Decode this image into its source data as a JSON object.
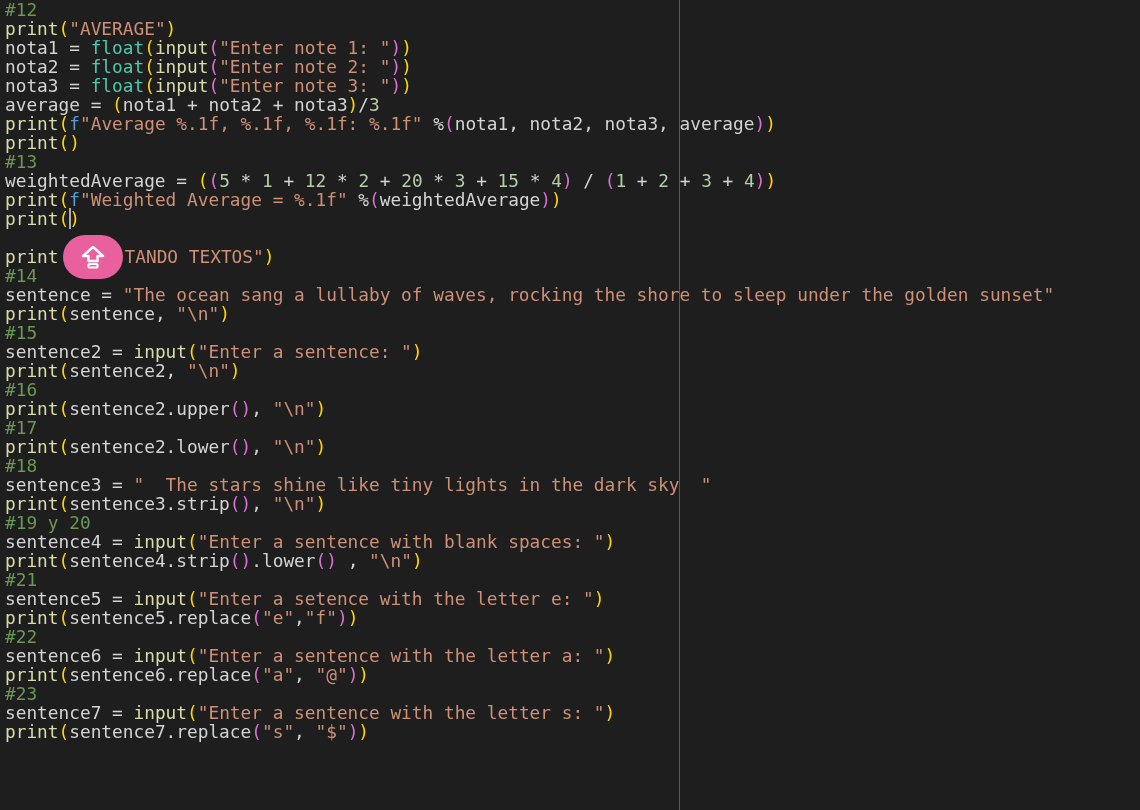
{
  "editor": {
    "lines": [
      {
        "kind": "code",
        "tokens": [
          {
            "kind": "comment",
            "text": "#12"
          }
        ]
      },
      {
        "kind": "code",
        "tokens": [
          {
            "kind": "fn",
            "text": "print"
          },
          {
            "kind": "paren1",
            "text": "("
          },
          {
            "kind": "string",
            "text": "\"AVERAGE\""
          },
          {
            "kind": "paren1",
            "text": ")"
          }
        ]
      },
      {
        "kind": "code",
        "tokens": [
          {
            "kind": "plain",
            "text": "nota1 = "
          },
          {
            "kind": "type",
            "text": "float"
          },
          {
            "kind": "paren1",
            "text": "("
          },
          {
            "kind": "fn",
            "text": "input"
          },
          {
            "kind": "paren2",
            "text": "("
          },
          {
            "kind": "string",
            "text": "\"Enter note 1: \""
          },
          {
            "kind": "paren2",
            "text": ")"
          },
          {
            "kind": "paren1",
            "text": ")"
          }
        ]
      },
      {
        "kind": "code",
        "tokens": [
          {
            "kind": "plain",
            "text": "nota2 = "
          },
          {
            "kind": "type",
            "text": "float"
          },
          {
            "kind": "paren1",
            "text": "("
          },
          {
            "kind": "fn",
            "text": "input"
          },
          {
            "kind": "paren2",
            "text": "("
          },
          {
            "kind": "string",
            "text": "\"Enter note 2: \""
          },
          {
            "kind": "paren2",
            "text": ")"
          },
          {
            "kind": "paren1",
            "text": ")"
          }
        ]
      },
      {
        "kind": "code",
        "tokens": [
          {
            "kind": "plain",
            "text": "nota3 = "
          },
          {
            "kind": "type",
            "text": "float"
          },
          {
            "kind": "paren1",
            "text": "("
          },
          {
            "kind": "fn",
            "text": "input"
          },
          {
            "kind": "paren2",
            "text": "("
          },
          {
            "kind": "string",
            "text": "\"Enter note 3: \""
          },
          {
            "kind": "paren2",
            "text": ")"
          },
          {
            "kind": "paren1",
            "text": ")"
          }
        ]
      },
      {
        "kind": "code",
        "tokens": [
          {
            "kind": "plain",
            "text": "average = "
          },
          {
            "kind": "paren1",
            "text": "("
          },
          {
            "kind": "plain",
            "text": "nota1 + nota2 + nota3"
          },
          {
            "kind": "paren1",
            "text": ")"
          },
          {
            "kind": "plain",
            "text": "/"
          },
          {
            "kind": "number",
            "text": "3"
          }
        ]
      },
      {
        "kind": "code",
        "tokens": [
          {
            "kind": "fn",
            "text": "print"
          },
          {
            "kind": "paren1",
            "text": "("
          },
          {
            "kind": "prefix",
            "text": "f"
          },
          {
            "kind": "string",
            "text": "\"Average %.1f, %.1f, %.1f: %.1f\""
          },
          {
            "kind": "plain",
            "text": " %"
          },
          {
            "kind": "paren2",
            "text": "("
          },
          {
            "kind": "plain",
            "text": "nota1, nota2, nota3, average"
          },
          {
            "kind": "paren2",
            "text": ")"
          },
          {
            "kind": "paren1",
            "text": ")"
          }
        ]
      },
      {
        "kind": "code",
        "tokens": [
          {
            "kind": "fn",
            "text": "print"
          },
          {
            "kind": "paren1",
            "text": "()"
          }
        ]
      },
      {
        "kind": "code",
        "tokens": [
          {
            "kind": "comment",
            "text": "#13"
          }
        ]
      },
      {
        "kind": "code",
        "tokens": [
          {
            "kind": "plain",
            "text": "weightedAverage = "
          },
          {
            "kind": "paren1",
            "text": "("
          },
          {
            "kind": "paren2",
            "text": "("
          },
          {
            "kind": "number",
            "text": "5"
          },
          {
            "kind": "plain",
            "text": " * "
          },
          {
            "kind": "number",
            "text": "1"
          },
          {
            "kind": "plain",
            "text": " + "
          },
          {
            "kind": "number",
            "text": "12"
          },
          {
            "kind": "plain",
            "text": " * "
          },
          {
            "kind": "number",
            "text": "2"
          },
          {
            "kind": "plain",
            "text": " + "
          },
          {
            "kind": "number",
            "text": "20"
          },
          {
            "kind": "plain",
            "text": " * "
          },
          {
            "kind": "number",
            "text": "3"
          },
          {
            "kind": "plain",
            "text": " + "
          },
          {
            "kind": "number",
            "text": "15"
          },
          {
            "kind": "plain",
            "text": " * "
          },
          {
            "kind": "number",
            "text": "4"
          },
          {
            "kind": "paren2",
            "text": ")"
          },
          {
            "kind": "plain",
            "text": " / "
          },
          {
            "kind": "paren2",
            "text": "("
          },
          {
            "kind": "number",
            "text": "1"
          },
          {
            "kind": "plain",
            "text": " + "
          },
          {
            "kind": "number",
            "text": "2"
          },
          {
            "kind": "plain",
            "text": " + "
          },
          {
            "kind": "number",
            "text": "3"
          },
          {
            "kind": "plain",
            "text": " + "
          },
          {
            "kind": "number",
            "text": "4"
          },
          {
            "kind": "paren2",
            "text": ")"
          },
          {
            "kind": "paren1",
            "text": ")"
          }
        ]
      },
      {
        "kind": "code",
        "tokens": [
          {
            "kind": "fn",
            "text": "print"
          },
          {
            "kind": "paren1",
            "text": "("
          },
          {
            "kind": "prefix",
            "text": "f"
          },
          {
            "kind": "string",
            "text": "\"Weighted Average = %.1f\""
          },
          {
            "kind": "plain",
            "text": " %"
          },
          {
            "kind": "paren2",
            "text": "("
          },
          {
            "kind": "plain",
            "text": "weightedAverage"
          },
          {
            "kind": "paren2",
            "text": ")"
          },
          {
            "kind": "paren1",
            "text": ")"
          }
        ]
      },
      {
        "kind": "code",
        "tokens": [
          {
            "kind": "fn",
            "text": "print"
          },
          {
            "kind": "paren1",
            "text": "("
          },
          {
            "kind": "paren1",
            "text": ")",
            "caret": true
          }
        ]
      },
      {
        "kind": "blank"
      },
      {
        "kind": "code",
        "tokens": [
          {
            "kind": "fn",
            "text": "print"
          },
          {
            "kind": "upload_button"
          },
          {
            "kind": "string",
            "text": "TANDO TEXTOS\""
          },
          {
            "kind": "paren1",
            "text": ")"
          }
        ]
      },
      {
        "kind": "code",
        "tokens": [
          {
            "kind": "comment",
            "text": "#14"
          }
        ]
      },
      {
        "kind": "code",
        "tokens": [
          {
            "kind": "plain",
            "text": "sentence = "
          },
          {
            "kind": "string",
            "text": "\"The ocean sang a lullaby of waves, rocking the shore to sleep under the golden sunset\""
          }
        ]
      },
      {
        "kind": "code",
        "tokens": [
          {
            "kind": "fn",
            "text": "print"
          },
          {
            "kind": "paren1",
            "text": "("
          },
          {
            "kind": "plain",
            "text": "sentence, "
          },
          {
            "kind": "string",
            "text": "\"\\n\""
          },
          {
            "kind": "paren1",
            "text": ")"
          }
        ]
      },
      {
        "kind": "code",
        "tokens": [
          {
            "kind": "comment",
            "text": "#15"
          }
        ]
      },
      {
        "kind": "code",
        "tokens": [
          {
            "kind": "plain",
            "text": "sentence2 = "
          },
          {
            "kind": "fn",
            "text": "input"
          },
          {
            "kind": "paren1",
            "text": "("
          },
          {
            "kind": "string",
            "text": "\"Enter a sentence: \""
          },
          {
            "kind": "paren1",
            "text": ")"
          }
        ]
      },
      {
        "kind": "code",
        "tokens": [
          {
            "kind": "fn",
            "text": "print"
          },
          {
            "kind": "paren1",
            "text": "("
          },
          {
            "kind": "plain",
            "text": "sentence2, "
          },
          {
            "kind": "string",
            "text": "\"\\n\""
          },
          {
            "kind": "paren1",
            "text": ")"
          }
        ]
      },
      {
        "kind": "code",
        "tokens": [
          {
            "kind": "comment",
            "text": "#16"
          }
        ]
      },
      {
        "kind": "code",
        "tokens": [
          {
            "kind": "fn",
            "text": "print"
          },
          {
            "kind": "paren1",
            "text": "("
          },
          {
            "kind": "plain",
            "text": "sentence2.upper"
          },
          {
            "kind": "paren2",
            "text": "()"
          },
          {
            "kind": "plain",
            "text": ", "
          },
          {
            "kind": "string",
            "text": "\"\\n\""
          },
          {
            "kind": "paren1",
            "text": ")"
          }
        ]
      },
      {
        "kind": "code",
        "tokens": [
          {
            "kind": "comment",
            "text": "#17"
          }
        ]
      },
      {
        "kind": "code",
        "tokens": [
          {
            "kind": "fn",
            "text": "print"
          },
          {
            "kind": "paren1",
            "text": "("
          },
          {
            "kind": "plain",
            "text": "sentence2.lower"
          },
          {
            "kind": "paren2",
            "text": "()"
          },
          {
            "kind": "plain",
            "text": ", "
          },
          {
            "kind": "string",
            "text": "\"\\n\""
          },
          {
            "kind": "paren1",
            "text": ")"
          }
        ]
      },
      {
        "kind": "code",
        "tokens": [
          {
            "kind": "comment",
            "text": "#18"
          }
        ]
      },
      {
        "kind": "code",
        "tokens": [
          {
            "kind": "plain",
            "text": "sentence3 = "
          },
          {
            "kind": "string",
            "text": "\"  The stars shine like tiny lights in the dark sky  \""
          }
        ]
      },
      {
        "kind": "code",
        "tokens": [
          {
            "kind": "fn",
            "text": "print"
          },
          {
            "kind": "paren1",
            "text": "("
          },
          {
            "kind": "plain",
            "text": "sentence3.strip"
          },
          {
            "kind": "paren2",
            "text": "()"
          },
          {
            "kind": "plain",
            "text": ", "
          },
          {
            "kind": "string",
            "text": "\"\\n\""
          },
          {
            "kind": "paren1",
            "text": ")"
          }
        ]
      },
      {
        "kind": "code",
        "tokens": [
          {
            "kind": "comment",
            "text": "#19 y 20"
          }
        ]
      },
      {
        "kind": "code",
        "tokens": [
          {
            "kind": "plain",
            "text": "sentence4 = "
          },
          {
            "kind": "fn",
            "text": "input"
          },
          {
            "kind": "paren1",
            "text": "("
          },
          {
            "kind": "string",
            "text": "\"Enter a sentence with blank spaces: \""
          },
          {
            "kind": "paren1",
            "text": ")"
          }
        ]
      },
      {
        "kind": "code",
        "tokens": [
          {
            "kind": "fn",
            "text": "print"
          },
          {
            "kind": "paren1",
            "text": "("
          },
          {
            "kind": "plain",
            "text": "sentence4.strip"
          },
          {
            "kind": "paren2",
            "text": "()"
          },
          {
            "kind": "plain",
            "text": ".lower"
          },
          {
            "kind": "paren2",
            "text": "()"
          },
          {
            "kind": "plain",
            "text": " , "
          },
          {
            "kind": "string",
            "text": "\"\\n\""
          },
          {
            "kind": "paren1",
            "text": ")"
          }
        ]
      },
      {
        "kind": "code",
        "tokens": [
          {
            "kind": "comment",
            "text": "#21"
          }
        ]
      },
      {
        "kind": "code",
        "tokens": [
          {
            "kind": "plain",
            "text": "sentence5 = "
          },
          {
            "kind": "fn",
            "text": "input"
          },
          {
            "kind": "paren1",
            "text": "("
          },
          {
            "kind": "string",
            "text": "\"Enter a setence with the letter e: \""
          },
          {
            "kind": "paren1",
            "text": ")"
          }
        ]
      },
      {
        "kind": "code",
        "tokens": [
          {
            "kind": "fn",
            "text": "print"
          },
          {
            "kind": "paren1",
            "text": "("
          },
          {
            "kind": "plain",
            "text": "sentence5.replace"
          },
          {
            "kind": "paren2",
            "text": "("
          },
          {
            "kind": "string",
            "text": "\"e\""
          },
          {
            "kind": "plain",
            "text": ","
          },
          {
            "kind": "string",
            "text": "\"f\""
          },
          {
            "kind": "paren2",
            "text": ")"
          },
          {
            "kind": "paren1",
            "text": ")"
          }
        ]
      },
      {
        "kind": "code",
        "tokens": [
          {
            "kind": "comment",
            "text": "#22"
          }
        ]
      },
      {
        "kind": "code",
        "tokens": [
          {
            "kind": "plain",
            "text": "sentence6 = "
          },
          {
            "kind": "fn",
            "text": "input"
          },
          {
            "kind": "paren1",
            "text": "("
          },
          {
            "kind": "string",
            "text": "\"Enter a sentence with the letter a: \""
          },
          {
            "kind": "paren1",
            "text": ")"
          }
        ]
      },
      {
        "kind": "code",
        "tokens": [
          {
            "kind": "fn",
            "text": "print"
          },
          {
            "kind": "paren1",
            "text": "("
          },
          {
            "kind": "plain",
            "text": "sentence6.replace"
          },
          {
            "kind": "paren2",
            "text": "("
          },
          {
            "kind": "string",
            "text": "\"a\""
          },
          {
            "kind": "plain",
            "text": ", "
          },
          {
            "kind": "string",
            "text": "\"@\""
          },
          {
            "kind": "paren2",
            "text": ")"
          },
          {
            "kind": "paren1",
            "text": ")"
          }
        ]
      },
      {
        "kind": "code",
        "tokens": [
          {
            "kind": "comment",
            "text": "#23"
          }
        ]
      },
      {
        "kind": "code",
        "tokens": [
          {
            "kind": "plain",
            "text": "sentence7 = "
          },
          {
            "kind": "fn",
            "text": "input"
          },
          {
            "kind": "paren1",
            "text": "("
          },
          {
            "kind": "string",
            "text": "\"Enter a sentence with the letter s: \""
          },
          {
            "kind": "paren1",
            "text": ")"
          }
        ]
      },
      {
        "kind": "code",
        "tokens": [
          {
            "kind": "fn",
            "text": "print"
          },
          {
            "kind": "paren1",
            "text": "("
          },
          {
            "kind": "plain",
            "text": "sentence7.replace"
          },
          {
            "kind": "paren2",
            "text": "("
          },
          {
            "kind": "string",
            "text": "\"s\""
          },
          {
            "kind": "plain",
            "text": ", "
          },
          {
            "kind": "string",
            "text": "\"$\""
          },
          {
            "kind": "paren2",
            "text": ")"
          },
          {
            "kind": "paren1",
            "text": ")"
          }
        ]
      }
    ]
  }
}
